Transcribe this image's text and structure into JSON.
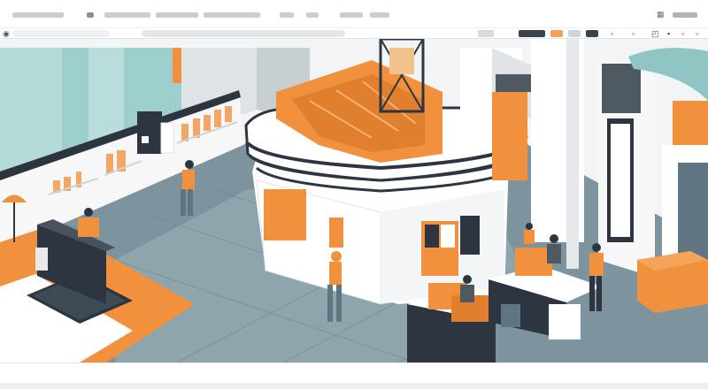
{
  "colors": {
    "accent": "#f2913d",
    "accent_dark": "#d9782a",
    "navy": "#2d3640",
    "slate": "#5f7682",
    "teal": "#8fc6c4",
    "floor": "#7d939d"
  },
  "menubar": {
    "icons": [
      "grid-icon",
      "window-controls-icon"
    ]
  },
  "toolbar": {
    "address_text": "",
    "search_text": "",
    "icons": [
      "back-icon",
      "forward-icon",
      "reload-icon",
      "share-icon",
      "bookmark-icon",
      "tab-icon",
      "menu-icon"
    ]
  },
  "status": {
    "text": ""
  }
}
